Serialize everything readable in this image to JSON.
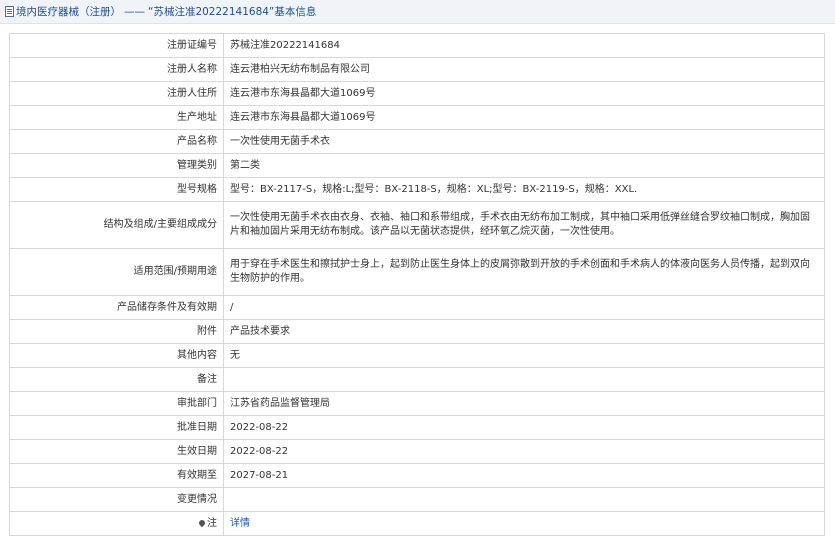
{
  "header": {
    "category": "境内医疗器械（注册）",
    "dash": "——",
    "title": "“苏械注准20222141684”基本信息"
  },
  "rows": [
    {
      "label": "注册证编号",
      "value": "苏械注准20222141684"
    },
    {
      "label": "注册人名称",
      "value": "连云港柏兴无纺布制品有限公司"
    },
    {
      "label": "注册人住所",
      "value": "连云港市东海县晶都大道1069号"
    },
    {
      "label": "生产地址",
      "value": "连云港市东海县晶都大道1069号"
    },
    {
      "label": "产品名称",
      "value": "一次性使用无菌手术衣"
    },
    {
      "label": "管理类别",
      "value": "第二类"
    },
    {
      "label": "型号规格",
      "value": "型号：BX-2117-S，规格:L;型号：BX-2118-S，规格：XL;型号：BX-2119-S，规格：XXL."
    },
    {
      "label": "结构及组成/主要组成成分",
      "value": "一次性使用无菌手术衣由衣身、衣袖、袖口和系带组成，手术衣由无纺布加工制成，其中袖口采用低弹丝缝合罗纹袖口制成，胸加固片和袖加固片采用无纺布制成。该产品以无菌状态提供，经环氧乙烷灭菌，一次性使用。"
    },
    {
      "label": "适用范围/预期用途",
      "value": "用于穿在手术医生和擦拭护士身上，起到防止医生身体上的皮屑弥散到开放的手术创面和手术病人的体液向医务人员传播，起到双向生物防护的作用。"
    },
    {
      "label": "产品储存条件及有效期",
      "value": "/"
    },
    {
      "label": "附件",
      "value": "产品技术要求"
    },
    {
      "label": "其他内容",
      "value": "无"
    },
    {
      "label": "备注",
      "value": ""
    },
    {
      "label": "审批部门",
      "value": "江苏省药品监督管理局"
    },
    {
      "label": "批准日期",
      "value": "2022-08-22"
    },
    {
      "label": "生效日期",
      "value": "2022-08-22"
    },
    {
      "label": "有效期至",
      "value": "2027-08-21"
    },
    {
      "label": "变更情况",
      "value": ""
    }
  ],
  "note": {
    "label": "注",
    "link": "详情",
    "icon": "pin-icon"
  }
}
